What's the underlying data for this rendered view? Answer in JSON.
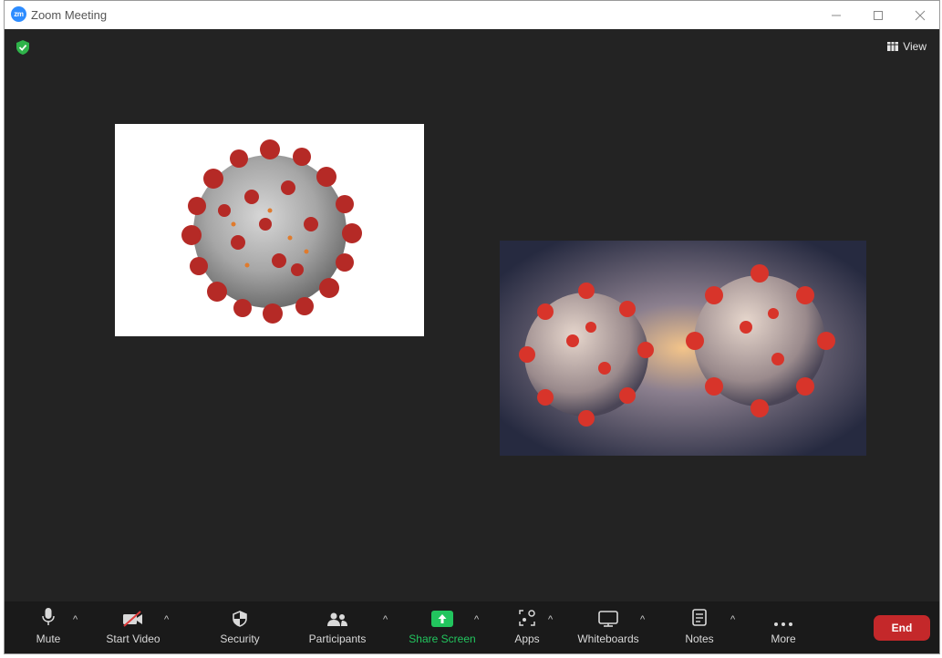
{
  "window": {
    "title": "Zoom Meeting",
    "logo_text": "zm",
    "controls": [
      "minimize",
      "maximize",
      "close"
    ]
  },
  "meeting": {
    "view_label": "View",
    "encryption_icon": "shield-check-icon",
    "tiles": [
      {
        "name": "video-tile-1",
        "content": "coronavirus illustration on white background"
      },
      {
        "name": "video-tile-2",
        "content": "two coronavirus particles close-up"
      }
    ]
  },
  "toolbar": {
    "mute_label": "Mute",
    "start_video_label": "Start Video",
    "security_label": "Security",
    "participants_label": "Participants",
    "share_screen_label": "Share Screen",
    "apps_label": "Apps",
    "whiteboards_label": "Whiteboards",
    "notes_label": "Notes",
    "more_label": "More",
    "end_label": "End"
  },
  "colors": {
    "stage": "#232323",
    "toolbar": "#1a1a1a",
    "share_green": "#22c55e",
    "end_red": "#c4282a",
    "logo_blue": "#2d8cff"
  }
}
